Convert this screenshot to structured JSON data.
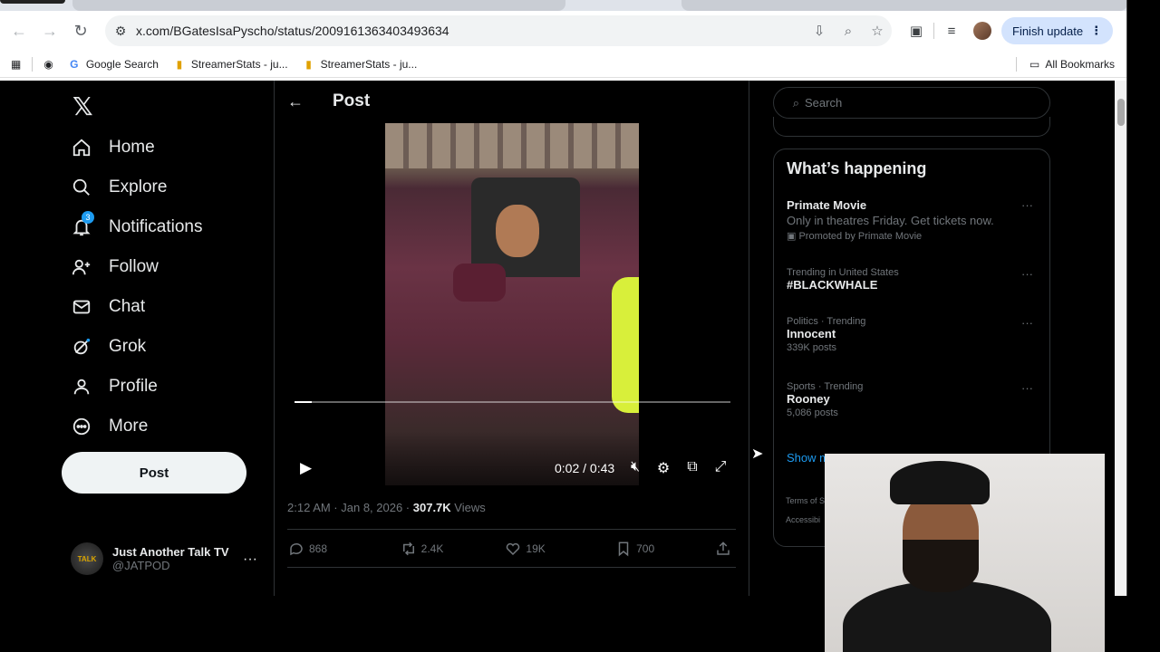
{
  "browser": {
    "url": "x.com/BGatesIsaPyscho/status/2009161363403493634",
    "finish_update": "Finish update",
    "bookmarks": [
      "Google Search",
      "StreamerStats - ju...",
      "StreamerStats - ju..."
    ],
    "all_bookmarks": "All Bookmarks"
  },
  "nav": {
    "items": [
      {
        "label": "Home",
        "icon": "home-icon"
      },
      {
        "label": "Explore",
        "icon": "search-icon"
      },
      {
        "label": "Notifications",
        "icon": "bell-icon",
        "badge": "3"
      },
      {
        "label": "Follow",
        "icon": "person-add-icon"
      },
      {
        "label": "Chat",
        "icon": "mail-icon"
      },
      {
        "label": "Grok",
        "icon": "grok-icon"
      },
      {
        "label": "Profile",
        "icon": "person-icon"
      },
      {
        "label": "More",
        "icon": "more-circle-icon"
      }
    ],
    "post_button": "Post"
  },
  "account": {
    "name": "Just Another Talk TV",
    "handle": "@JATPOD",
    "avatar_text": "TALK"
  },
  "main": {
    "title": "Post",
    "video": {
      "time": "0:02 / 0:43",
      "progress": 0.04
    },
    "meta": {
      "time": "2:12 AM · Jan 8, 2026 · ",
      "views_count": "307.7K",
      "views_label": " Views"
    },
    "actions": {
      "replies": "868",
      "reposts": "2.4K",
      "likes": "19K",
      "bookmarks": "700"
    }
  },
  "sidebar": {
    "search_placeholder": "Search",
    "trends_title": "What’s happening",
    "trends": [
      {
        "title": "Primate Movie",
        "sub": "Only in theatres Friday. Get tickets now.",
        "promo": "Promoted by Primate Movie"
      },
      {
        "context": "Trending in United States",
        "title": "#BLACKWHALE"
      },
      {
        "context": "Politics · Trending",
        "title": "Innocent",
        "count": "339K posts"
      },
      {
        "context": "Sports · Trending",
        "title": "Rooney",
        "count": "5,086 posts"
      }
    ],
    "show_more": "Show m",
    "footer_a": "Terms of S",
    "footer_b": "Accessibi"
  },
  "colors": {
    "accent": "#1d9bf0",
    "background": "#000000",
    "text": "#e7e9ea",
    "muted": "#71767b"
  }
}
